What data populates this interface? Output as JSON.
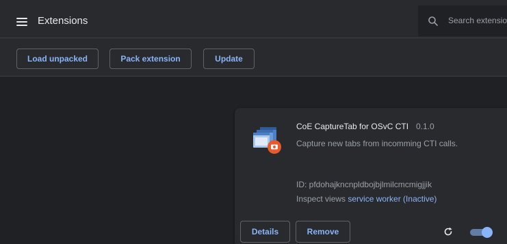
{
  "header": {
    "title": "Extensions",
    "menu_icon": "hamburger-menu-icon",
    "search": {
      "icon": "search-icon",
      "placeholder": "Search extensions",
      "value": ""
    }
  },
  "toolbar": {
    "load_unpacked_label": "Load unpacked",
    "pack_extension_label": "Pack extension",
    "update_label": "Update"
  },
  "extension": {
    "name": "CoE CaptureTab for OSvC CTI",
    "version": "0.1.0",
    "description": "Capture new tabs from incomming CTI calls.",
    "id_text": "ID: pfdohajkncnpldbojbjlmilcmcmigjjik",
    "inspect_label": "Inspect views",
    "inspect_link": "service worker (Inactive)",
    "details_label": "Details",
    "remove_label": "Remove",
    "reload_icon": "reload-icon",
    "enabled": true
  },
  "colors": {
    "background": "#202124",
    "surface": "#292a2d",
    "accent": "#8ab4f8",
    "text_primary": "#e8eaed",
    "text_secondary": "#9aa0a6",
    "badge_orange": "#e8592b"
  }
}
